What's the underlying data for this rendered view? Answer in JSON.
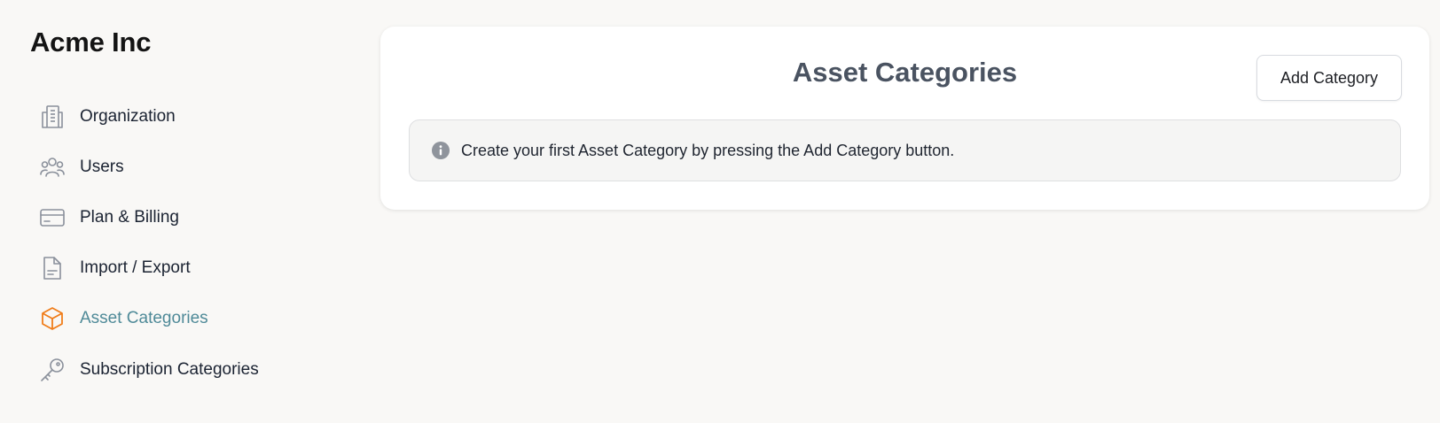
{
  "sidebar": {
    "org_name": "Acme Inc",
    "items": [
      {
        "label": "Organization",
        "icon": "building-icon"
      },
      {
        "label": "Users",
        "icon": "users-icon"
      },
      {
        "label": "Plan & Billing",
        "icon": "credit-card-icon"
      },
      {
        "label": "Import / Export",
        "icon": "document-icon"
      },
      {
        "label": "Asset Categories",
        "icon": "cube-icon",
        "active": true
      },
      {
        "label": "Subscription Categories",
        "icon": "key-icon"
      }
    ]
  },
  "main": {
    "title": "Asset Categories",
    "add_button_label": "Add Category",
    "info_message": "Create your first Asset Category by pressing the Add Category button."
  },
  "colors": {
    "background": "#f9f8f6",
    "active_label": "#4f8a98",
    "active_icon": "#f07d1a",
    "icon_default": "#8a909b",
    "title": "#4a5361"
  }
}
